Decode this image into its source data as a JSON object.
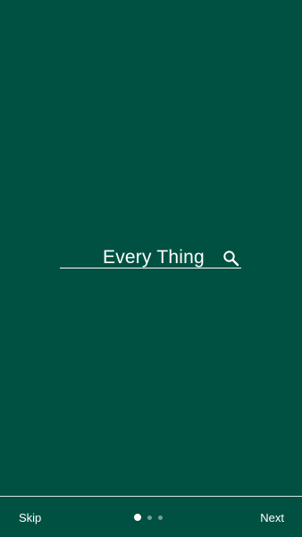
{
  "colors": {
    "background": "#005142",
    "foreground": "#ffffff"
  },
  "search": {
    "text": "Every Thing",
    "icon": "search-icon"
  },
  "bottom_bar": {
    "skip_label": "Skip",
    "next_label": "Next",
    "pager": {
      "total": 3,
      "active_index": 0
    }
  }
}
